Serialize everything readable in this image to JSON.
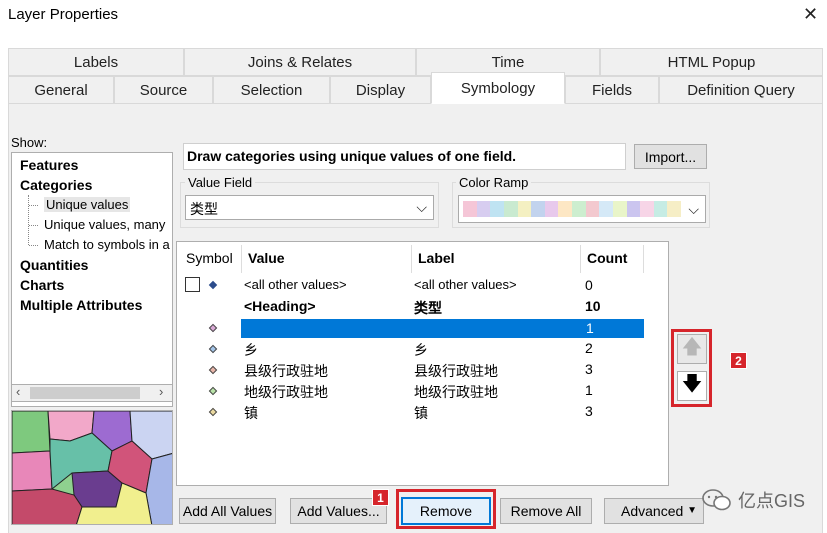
{
  "window": {
    "title": "Layer Properties",
    "close_glyph": "✕"
  },
  "tabs_row1": [
    {
      "label": "Labels"
    },
    {
      "label": "Joins & Relates"
    },
    {
      "label": "Time"
    },
    {
      "label": "HTML Popup"
    }
  ],
  "tabs_row2": [
    {
      "label": "General"
    },
    {
      "label": "Source"
    },
    {
      "label": "Selection"
    },
    {
      "label": "Display"
    },
    {
      "label": "Symbology",
      "active": true
    },
    {
      "label": "Fields"
    },
    {
      "label": "Definition Query"
    }
  ],
  "show": {
    "label": "Show:",
    "items": [
      {
        "label": "Features",
        "bold": true
      },
      {
        "label": "Categories",
        "bold": true
      },
      {
        "label": "Unique values",
        "selected": true
      },
      {
        "label": "Unique values, many"
      },
      {
        "label": "Match to symbols in a"
      },
      {
        "label": "Quantities",
        "bold": true
      },
      {
        "label": "Charts",
        "bold": true
      },
      {
        "label": "Multiple Attributes",
        "bold": true
      }
    ]
  },
  "description": "Draw categories using unique values of one field.",
  "import_button": "Import...",
  "value_field": {
    "label": "Value Field",
    "value": "类型"
  },
  "color_ramp": {
    "label": "Color Ramp",
    "colors": [
      "#f5c6d7",
      "#d7cdf0",
      "#bfe3f2",
      "#c9ead0",
      "#f4f0c2",
      "#c2d3ee",
      "#e8c9ec",
      "#fde7c4",
      "#cdeecf",
      "#f3c9cf",
      "#d5e9f7",
      "#e9f5c9",
      "#cbc5ef",
      "#f7d5e7",
      "#c6ece4",
      "#f6eec6"
    ]
  },
  "table": {
    "headers": {
      "symbol": "Symbol",
      "value": "Value",
      "label": "Label",
      "count": "Count"
    },
    "rows": [
      {
        "value": "<all other values>",
        "label": "<all other values>",
        "count": "0",
        "color": "#2b4c8c"
      },
      {
        "value": "<Heading>",
        "label": "类型",
        "count": "10",
        "heading": true
      },
      {
        "value": "",
        "label": "",
        "count": "1",
        "selected": true,
        "color": "#d9a9d5"
      },
      {
        "value": "乡",
        "label": "乡",
        "count": "2",
        "color": "#a3c4e8"
      },
      {
        "value": "县级行政驻地",
        "label": "县级行政驻地",
        "count": "3",
        "color": "#e8b5a8"
      },
      {
        "value": "地级行政驻地",
        "label": "地级行政驻地",
        "count": "1",
        "color": "#b9e3a8"
      },
      {
        "value": "镇",
        "label": "镇",
        "count": "3",
        "color": "#ead9a0"
      }
    ]
  },
  "move_up": "🡅",
  "move_down": "🡇",
  "buttons": {
    "add_all": "Add All Values",
    "add_values": "Add Values...",
    "remove": "Remove",
    "remove_all": "Remove All",
    "advanced": "Advanced"
  },
  "markers": {
    "one": "1",
    "two": "2"
  },
  "watermark": "亿点GIS",
  "accent": "#0078d7",
  "highlight_red": "#d6252b"
}
